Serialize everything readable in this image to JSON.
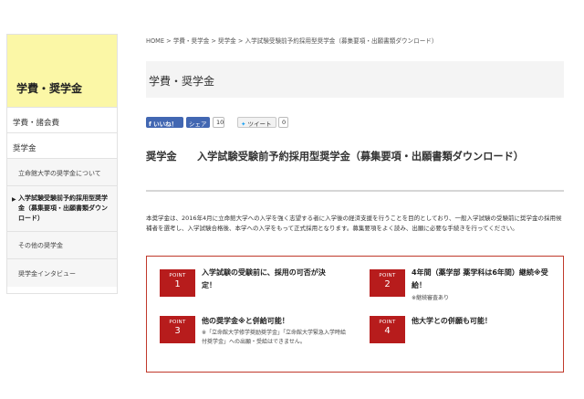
{
  "sidebar": {
    "header": "学費・奨学金",
    "items": [
      {
        "label": "学費・諸会費"
      },
      {
        "label": "奨学金"
      }
    ],
    "subitems": [
      {
        "label": "立命館大学の奨学金について"
      },
      {
        "label": "入学試験受験前予約採用型奨学金（募集要項・出願書類ダウンロード）"
      },
      {
        "label": "その他の奨学金"
      },
      {
        "label": "奨学金インタビュー"
      }
    ]
  },
  "breadcrumb": "HOME > 学費・奨学金 > 奨学金 > 入学試験受験前予約採用型奨学金（募集要項・出願書類ダウンロード）",
  "page_title": "学費・奨学金",
  "social": {
    "facebook_like": "いいね！",
    "facebook_share": "シェア",
    "facebook_count": "10",
    "tweet": "ツイート",
    "tweet_count": "0"
  },
  "heading": "奨学金　　入学試験受験前予約採用型奨学金（募集要項・出願書類ダウンロード）",
  "intro": "本奨学金は、2016年4月に立命館大学への入学を強く志望する者に入学後の経済支援を行うことを目的としており、一般入学試験の受験前に奨学金の採用候補者を選考し、入学試験合格後、本学への入学をもって正式採用となります。募集要項をよく読み、出願に必要な手続きを行ってください。",
  "points": [
    {
      "label": "POINT",
      "num": "1",
      "title": "入学試験の受験前に、採用の可否が決定！",
      "note": ""
    },
    {
      "label": "POINT",
      "num": "2",
      "title": "4年間（薬学部 薬学科は6年間）継続※受給！",
      "note": "※継続審査あり"
    },
    {
      "label": "POINT",
      "num": "3",
      "title": "他の奨学金※と併給可能！",
      "note": "※「立命館大学修学奨励奨学金」「立命館大学緊急入学時給付奨学金」への出願・受給はできません。"
    },
    {
      "label": "POINT",
      "num": "4",
      "title": "他大学との併願も可能！",
      "note": ""
    }
  ],
  "colors": {
    "accent": "#b71c1c",
    "sidebar_header_bg": "#fbf7a6",
    "facebook": "#4267b2"
  }
}
